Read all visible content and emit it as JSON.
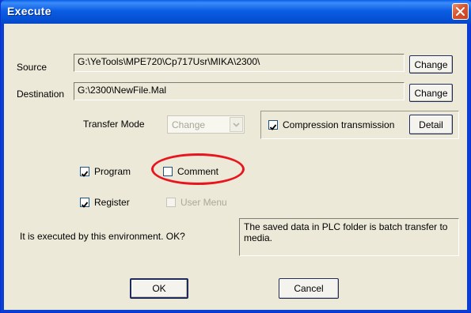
{
  "window": {
    "title": "Execute"
  },
  "source": {
    "label": "Source",
    "path": "G:\\YeTools\\MPE720\\Cp717Usr\\MIKA\\2300\\",
    "change_label": "Change"
  },
  "destination": {
    "label": "Destination",
    "path": "G:\\2300\\NewFile.Mal",
    "change_label": "Change"
  },
  "transfer_mode": {
    "label": "Transfer Mode",
    "selected": "Change"
  },
  "compression": {
    "label": "Compression transmission",
    "checked": true,
    "detail_label": "Detail"
  },
  "options": {
    "program": {
      "label": "Program",
      "checked": true
    },
    "comment": {
      "label": "Comment",
      "checked": false
    },
    "register": {
      "label": "Register",
      "checked": true
    },
    "user_menu": {
      "label": "User Menu",
      "checked": false,
      "disabled": true
    }
  },
  "prompt": "It is executed by this environment. OK?",
  "info": "The saved data in PLC folder is batch transfer to media.",
  "buttons": {
    "ok": "OK",
    "cancel": "Cancel"
  },
  "colors": {
    "title_bar": "#0a5fe8",
    "dialog_bg": "#ece9d8",
    "highlight_ellipse": "#e8141e",
    "close_button": "#d8542d"
  },
  "annotations": {
    "highlight": "red ellipse around Comment checkbox"
  }
}
